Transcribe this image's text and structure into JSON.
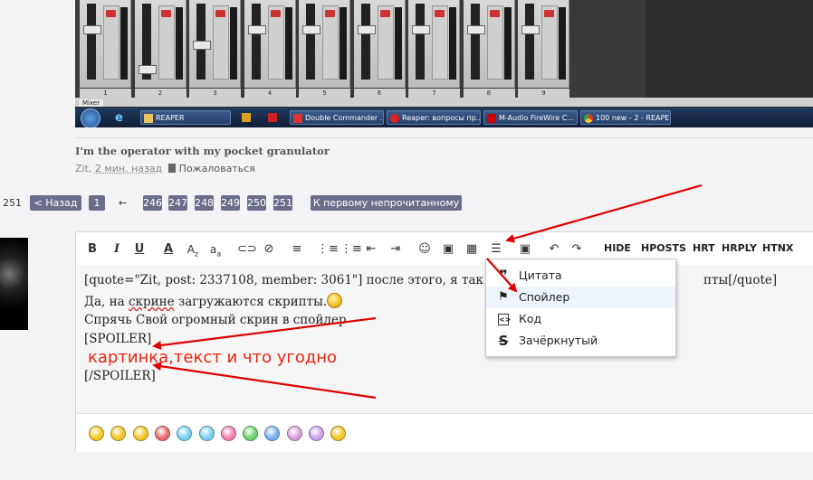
{
  "screenshot": {
    "channels": [
      "1",
      "2",
      "3",
      "4",
      "5",
      "6",
      "7",
      "8",
      "9"
    ],
    "mixer_tab": "Mixer",
    "taskbar": [
      {
        "label": "REAPER",
        "icon": "folder-icon"
      },
      {
        "label": "Double Commander ...",
        "icon": "double-commander-icon"
      },
      {
        "label": "Reaper: вопросы пр...",
        "icon": "opera-icon"
      },
      {
        "label": "M-Audio FireWire C...",
        "icon": "maudio-icon"
      },
      {
        "label": "100 new - 2 - REAPE...",
        "icon": "chrome-icon"
      }
    ]
  },
  "post": {
    "signature": "I'm the operator with my pocket granulator",
    "author": "Zit",
    "time": "2 мин. назад",
    "report": "Пожаловаться"
  },
  "pager": {
    "total": "251",
    "back": "< Назад",
    "first": "1",
    "ellipsis": "←",
    "pages": [
      "246",
      "247",
      "248",
      "249",
      "250",
      "251"
    ],
    "first_unread": "К первому непрочитанному"
  },
  "editor": {
    "toolbar_text_buttons": [
      "HIDE",
      "HPOSTS",
      "HRT",
      "HRPLY",
      "HTNX"
    ],
    "lines": {
      "quote": "[quote=\"Zit, post: 2337108, member: 3061\"] после этого, я так пола",
      "quote_end": "пты[/quote]",
      "line2_a": "Да, на ",
      "line2_b": "скрине",
      "line2_c": " загружаются скрипты.",
      "line3": "Спрячь Свой огромный скрин в спойлер",
      "line4": "[SPOILER]",
      "line5": "картинка,текст и что угодно",
      "line6": "[/SPOILER]"
    }
  },
  "menu": {
    "items": [
      {
        "label": "Цитата",
        "icon": "quote-icon"
      },
      {
        "label": "Спойлер",
        "icon": "flag-icon"
      },
      {
        "label": "Код",
        "icon": "code-icon"
      },
      {
        "label": "Зачёркнутый",
        "icon": "strikethrough-icon"
      }
    ]
  },
  "colors": {
    "accent": "#6b6e8a",
    "arrow": "#e00000",
    "annotation": "#e21111"
  }
}
